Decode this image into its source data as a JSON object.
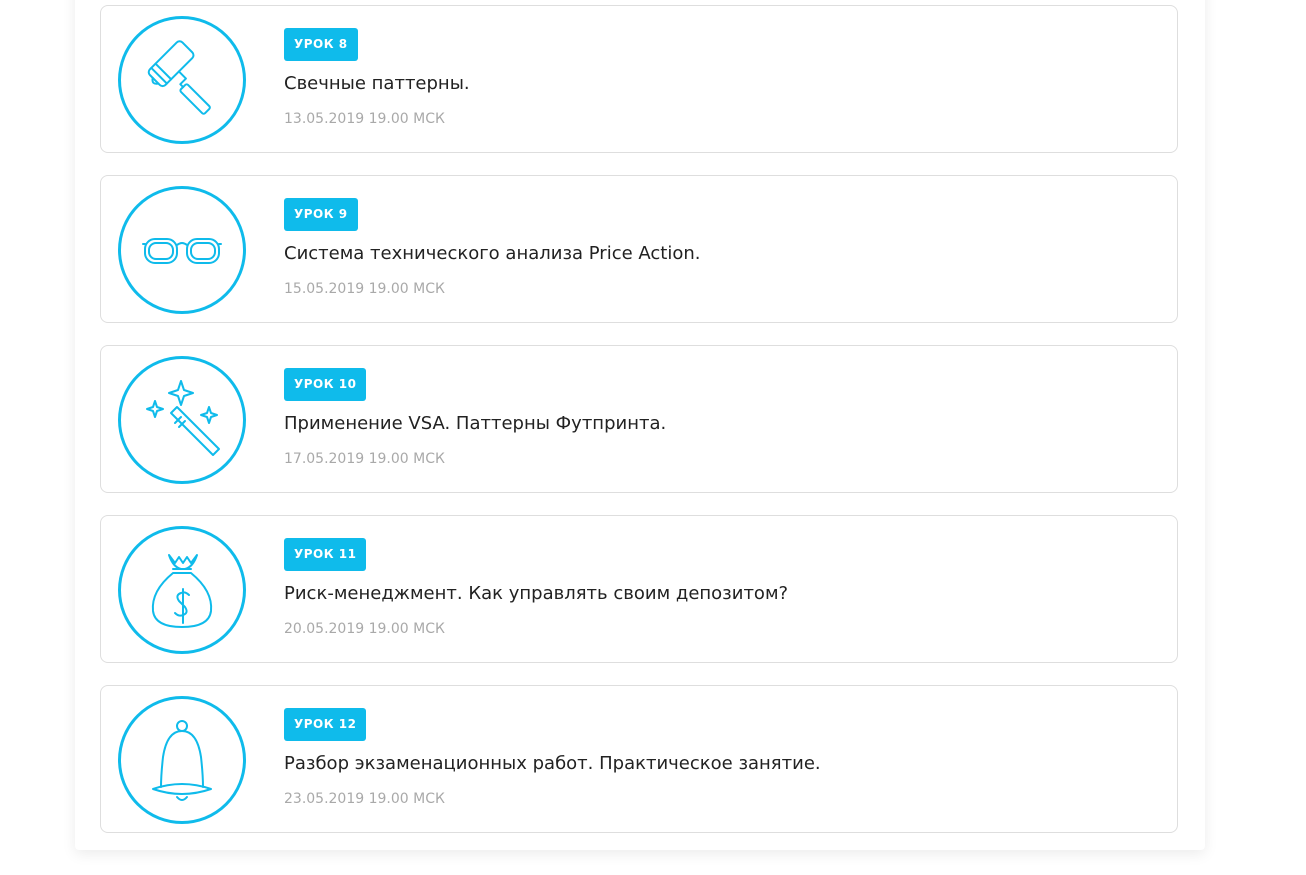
{
  "colors": {
    "accent": "#0fbbeb",
    "title_text": "#222222",
    "date_text": "#a9a9a9",
    "card_border": "#dedede"
  },
  "lessons": [
    {
      "badge": "УРОК 8",
      "title": "Свечные паттерны.",
      "date": "13.05.2019 19.00 МСК",
      "icon": "paint-roller-icon"
    },
    {
      "badge": "УРОК 9",
      "title": "Система технического анализа Price Action.",
      "date": "15.05.2019 19.00 МСК",
      "icon": "glasses-icon"
    },
    {
      "badge": "УРОК 10",
      "title": "Применение VSA. Паттерны Футпринта.",
      "date": "17.05.2019 19.00 МСК",
      "icon": "magic-wand-icon"
    },
    {
      "badge": "УРОК 11",
      "title": "Риск-менеджмент. Как управлять своим депозитом?",
      "date": "20.05.2019 19.00 МСК",
      "icon": "money-bag-icon"
    },
    {
      "badge": "УРОК 12",
      "title": "Разбор экзаменационных работ. Практическое занятие.",
      "date": "23.05.2019 19.00 МСК",
      "icon": "bell-icon"
    }
  ]
}
